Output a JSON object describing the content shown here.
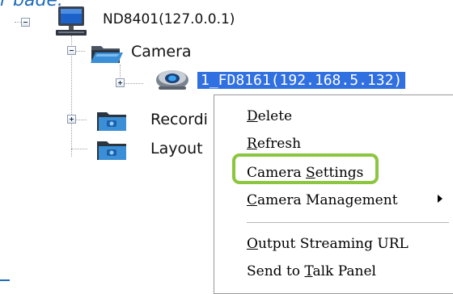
{
  "caption": {
    "text": "r bade:"
  },
  "tree": {
    "root": {
      "label": "ND8401(127.0.0.1)",
      "expander": "minus",
      "icon": "monitor-icon"
    },
    "camera_folder": {
      "label": "Camera",
      "expander": "minus",
      "icon": "open-folder-icon"
    },
    "camera_item": {
      "label": "1_FD8161(192.168.5.132)",
      "expander": "plus",
      "icon": "dome-camera-icon",
      "selected": true
    },
    "recording_folder": {
      "label": "Recordi",
      "expander": "plus",
      "icon": "folder-icon"
    },
    "layout_folder": {
      "label": "Layout",
      "icon": "folder-icon"
    }
  },
  "context_menu": {
    "items": [
      {
        "pre": "",
        "u": "D",
        "post": "elete"
      },
      {
        "pre": "",
        "u": "R",
        "post": "efresh"
      },
      {
        "pre": "Camera ",
        "u": "S",
        "post": "ettings",
        "highlighted": true
      },
      {
        "pre": "",
        "u": "C",
        "post": "amera Management",
        "submenu": true
      },
      {
        "pre": "",
        "u": "O",
        "post": "utput Streaming URL"
      },
      {
        "pre": "Send to ",
        "u": "T",
        "post": "alk Panel"
      }
    ]
  },
  "colors": {
    "selection": "#3170e0",
    "highlight_outline": "#8cc63e",
    "caption": "#1f6ab7",
    "folder_blue": "#3a8fd6"
  }
}
